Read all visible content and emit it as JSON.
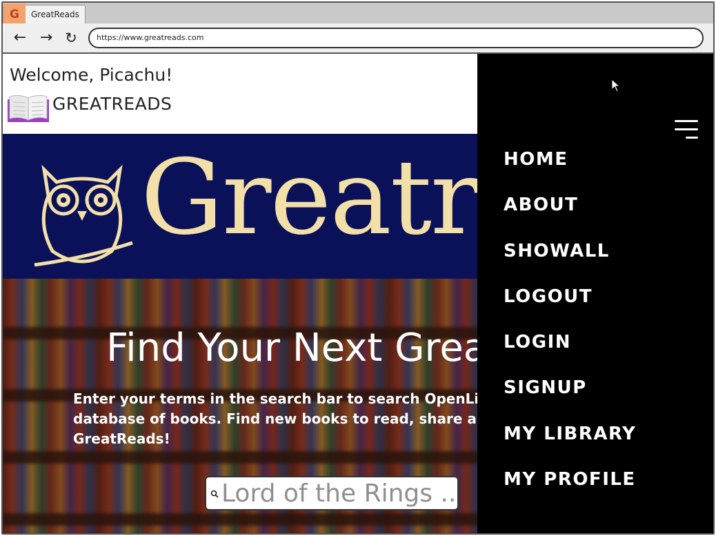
{
  "browser": {
    "tab_title": "GreatReads",
    "favicon_letter": "G",
    "url": "https://www.greatreads.com",
    "back_icon": "arrow-left-icon",
    "forward_icon": "arrow-right-icon",
    "reload_icon": "reload-icon"
  },
  "header": {
    "welcome": "Welcome, Picachu!",
    "brand": "GREATREADS",
    "brand_icon": "book-icon"
  },
  "banner": {
    "logo_text": "Greatreads",
    "logo_icon": "owl-icon",
    "colors": {
      "background": "#0a1158",
      "logo": "#f3dfa8"
    }
  },
  "hero": {
    "title": "Find Your Next Great Read",
    "description": "Enter your terms in the search bar to search OpenLibrary's database of books.  Find new books to read, share and save to GreatReads!",
    "search": {
      "placeholder": "Lord of the Rings ...",
      "icon": "search-icon"
    }
  },
  "menu": {
    "icon": "hamburger-icon",
    "items": [
      {
        "label": "HOME"
      },
      {
        "label": "ABOUT"
      },
      {
        "label": "SHOWALL"
      },
      {
        "label": "LOGOUT"
      },
      {
        "label": "LOGIN"
      },
      {
        "label": "SIGNUP"
      },
      {
        "label": "MY LIBRARY"
      },
      {
        "label": "MY PROFILE"
      }
    ],
    "colors": {
      "background": "#000000",
      "text": "#ffffff"
    }
  }
}
